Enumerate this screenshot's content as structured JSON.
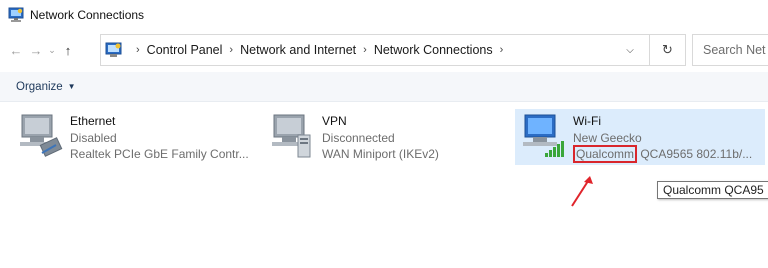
{
  "window": {
    "title": "Network Connections",
    "icon": "network-connections-icon"
  },
  "navigation": {
    "back_icon": "arrow-left-icon",
    "forward_icon": "arrow-right-icon",
    "recent_icon": "chevron-down-icon",
    "up_icon": "arrow-up-icon"
  },
  "address_bar": {
    "breadcrumbs": [
      "Control Panel",
      "Network and Internet",
      "Network Connections"
    ],
    "separator": "›",
    "refresh_icon": "refresh-icon"
  },
  "search": {
    "placeholder": "Search Net"
  },
  "command_bar": {
    "organize_label": "Organize"
  },
  "connections": [
    {
      "name": "Ethernet",
      "status": "Disabled",
      "device": "Realtek PCIe GbE Family Contr..."
    },
    {
      "name": "VPN",
      "status": "Disconnected",
      "device": "WAN Miniport (IKEv2)"
    },
    {
      "name": "Wi-Fi",
      "status": "New Geecko",
      "device_highlighted": "Qualcomm",
      "device_rest": " QCA9565 802.11b/...",
      "selected": true
    }
  ],
  "tooltip": {
    "text": "Qualcomm QCA95"
  },
  "annotation": {
    "highlight_color": "#d9262c",
    "arrow_color": "#e0242b"
  }
}
